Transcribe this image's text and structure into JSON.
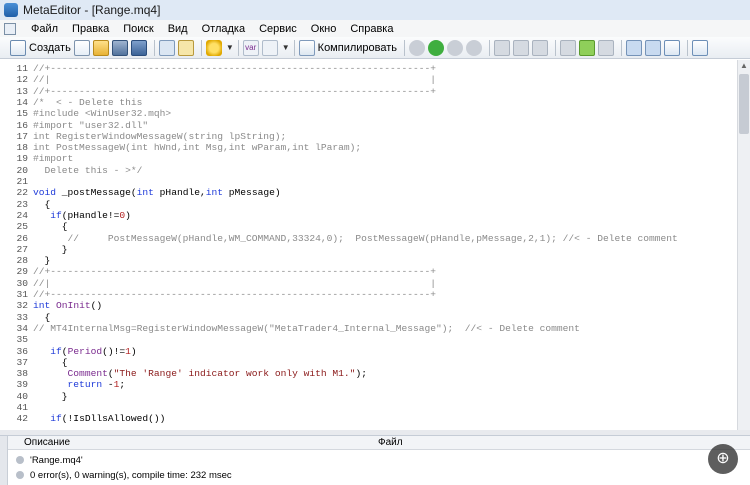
{
  "window": {
    "title": "MetaEditor - [Range.mq4]"
  },
  "menu": [
    "Файл",
    "Правка",
    "Поиск",
    "Вид",
    "Отладка",
    "Сервис",
    "Окно",
    "Справка"
  ],
  "toolbar": {
    "create_label": "Создать",
    "compile_label": "Компилировать",
    "var_label": "var"
  },
  "code": [
    {
      "n": "11",
      "toks": [
        {
          "t": "comment",
          "v": "//+------------------------------------------------------------------+"
        }
      ]
    },
    {
      "n": "12",
      "toks": [
        {
          "t": "comment",
          "v": "//|                                                                  |"
        }
      ]
    },
    {
      "n": "13",
      "toks": [
        {
          "t": "comment",
          "v": "//+------------------------------------------------------------------+"
        }
      ]
    },
    {
      "n": "14",
      "toks": [
        {
          "t": "comment",
          "v": "/*  < - Delete this"
        }
      ]
    },
    {
      "n": "15",
      "toks": [
        {
          "t": "comment",
          "v": "#include <WinUser32.mqh>"
        }
      ]
    },
    {
      "n": "16",
      "toks": [
        {
          "t": "comment",
          "v": "#import \"user32.dll\""
        }
      ]
    },
    {
      "n": "17",
      "toks": [
        {
          "t": "comment",
          "v": "int RegisterWindowMessageW(string lpString);"
        }
      ]
    },
    {
      "n": "18",
      "toks": [
        {
          "t": "comment",
          "v": "int PostMessageW(int hWnd,int Msg,int wParam,int lParam);"
        }
      ]
    },
    {
      "n": "19",
      "toks": [
        {
          "t": "comment",
          "v": "#import"
        }
      ]
    },
    {
      "n": "20",
      "toks": [
        {
          "t": "comment",
          "v": "  Delete this - >*/"
        }
      ]
    },
    {
      "n": "21",
      "toks": []
    },
    {
      "n": "22",
      "toks": [
        {
          "t": "keyword",
          "v": "void"
        },
        {
          "t": "plain",
          "v": " _postMessage("
        },
        {
          "t": "keyword",
          "v": "int"
        },
        {
          "t": "plain",
          "v": " pHandle,"
        },
        {
          "t": "keyword",
          "v": "int"
        },
        {
          "t": "plain",
          "v": " pMessage)"
        }
      ]
    },
    {
      "n": "23",
      "toks": [
        {
          "t": "plain",
          "v": "  {"
        }
      ]
    },
    {
      "n": "24",
      "toks": [
        {
          "t": "plain",
          "v": "   "
        },
        {
          "t": "keyword",
          "v": "if"
        },
        {
          "t": "plain",
          "v": "(pHandle!="
        },
        {
          "t": "number",
          "v": "0"
        },
        {
          "t": "plain",
          "v": ")"
        }
      ]
    },
    {
      "n": "25",
      "toks": [
        {
          "t": "plain",
          "v": "     {"
        }
      ]
    },
    {
      "n": "26",
      "toks": [
        {
          "t": "comment",
          "v": "      //     PostMessageW(pHandle,WM_COMMAND,33324,0);  PostMessageW(pHandle,pMessage,2,1); //< - Delete comment"
        }
      ]
    },
    {
      "n": "27",
      "toks": [
        {
          "t": "plain",
          "v": "     }"
        }
      ]
    },
    {
      "n": "28",
      "toks": [
        {
          "t": "plain",
          "v": "  }"
        }
      ]
    },
    {
      "n": "29",
      "toks": [
        {
          "t": "comment",
          "v": "//+------------------------------------------------------------------+"
        }
      ]
    },
    {
      "n": "30",
      "toks": [
        {
          "t": "comment",
          "v": "//|                                                                  |"
        }
      ]
    },
    {
      "n": "31",
      "toks": [
        {
          "t": "comment",
          "v": "//+------------------------------------------------------------------+"
        }
      ]
    },
    {
      "n": "32",
      "toks": [
        {
          "t": "keyword",
          "v": "int"
        },
        {
          "t": "plain",
          "v": " "
        },
        {
          "t": "func",
          "v": "OnInit"
        },
        {
          "t": "plain",
          "v": "()"
        }
      ]
    },
    {
      "n": "33",
      "toks": [
        {
          "t": "plain",
          "v": "  {"
        }
      ]
    },
    {
      "n": "34",
      "toks": [
        {
          "t": "comment",
          "v": "// MT4InternalMsg=RegisterWindowMessageW(\"MetaTrader4_Internal_Message\");  //< - Delete comment"
        }
      ]
    },
    {
      "n": "35",
      "toks": []
    },
    {
      "n": "36",
      "toks": [
        {
          "t": "plain",
          "v": "   "
        },
        {
          "t": "keyword",
          "v": "if"
        },
        {
          "t": "plain",
          "v": "("
        },
        {
          "t": "func",
          "v": "Period"
        },
        {
          "t": "plain",
          "v": "()!="
        },
        {
          "t": "number",
          "v": "1"
        },
        {
          "t": "plain",
          "v": ")"
        }
      ]
    },
    {
      "n": "37",
      "toks": [
        {
          "t": "plain",
          "v": "     {"
        }
      ]
    },
    {
      "n": "38",
      "toks": [
        {
          "t": "plain",
          "v": "      "
        },
        {
          "t": "func",
          "v": "Comment"
        },
        {
          "t": "plain",
          "v": "("
        },
        {
          "t": "string",
          "v": "\"The 'Range' indicator work only with M1.\""
        },
        {
          "t": "plain",
          "v": ");"
        }
      ]
    },
    {
      "n": "39",
      "toks": [
        {
          "t": "plain",
          "v": "      "
        },
        {
          "t": "keyword",
          "v": "return"
        },
        {
          "t": "plain",
          "v": " -"
        },
        {
          "t": "number",
          "v": "1"
        },
        {
          "t": "plain",
          "v": ";"
        }
      ]
    },
    {
      "n": "40",
      "toks": [
        {
          "t": "plain",
          "v": "     }"
        }
      ]
    },
    {
      "n": "41",
      "toks": []
    },
    {
      "n": "42",
      "toks": [
        {
          "t": "plain",
          "v": "   "
        },
        {
          "t": "keyword",
          "v": "if"
        },
        {
          "t": "plain",
          "v": "(!IsDllsAllowed())"
        }
      ]
    }
  ],
  "panel": {
    "col_description": "Описание",
    "col_file": "Файл",
    "rows": [
      "'Range.mq4'",
      "0 error(s), 0 warning(s), compile time: 232 msec"
    ]
  },
  "colors": {
    "keyword": "#1f3bd9",
    "comment": "#8a8a8a",
    "string": "#8b1a1a",
    "number": "#b22222",
    "func": "#7b2c8f"
  }
}
